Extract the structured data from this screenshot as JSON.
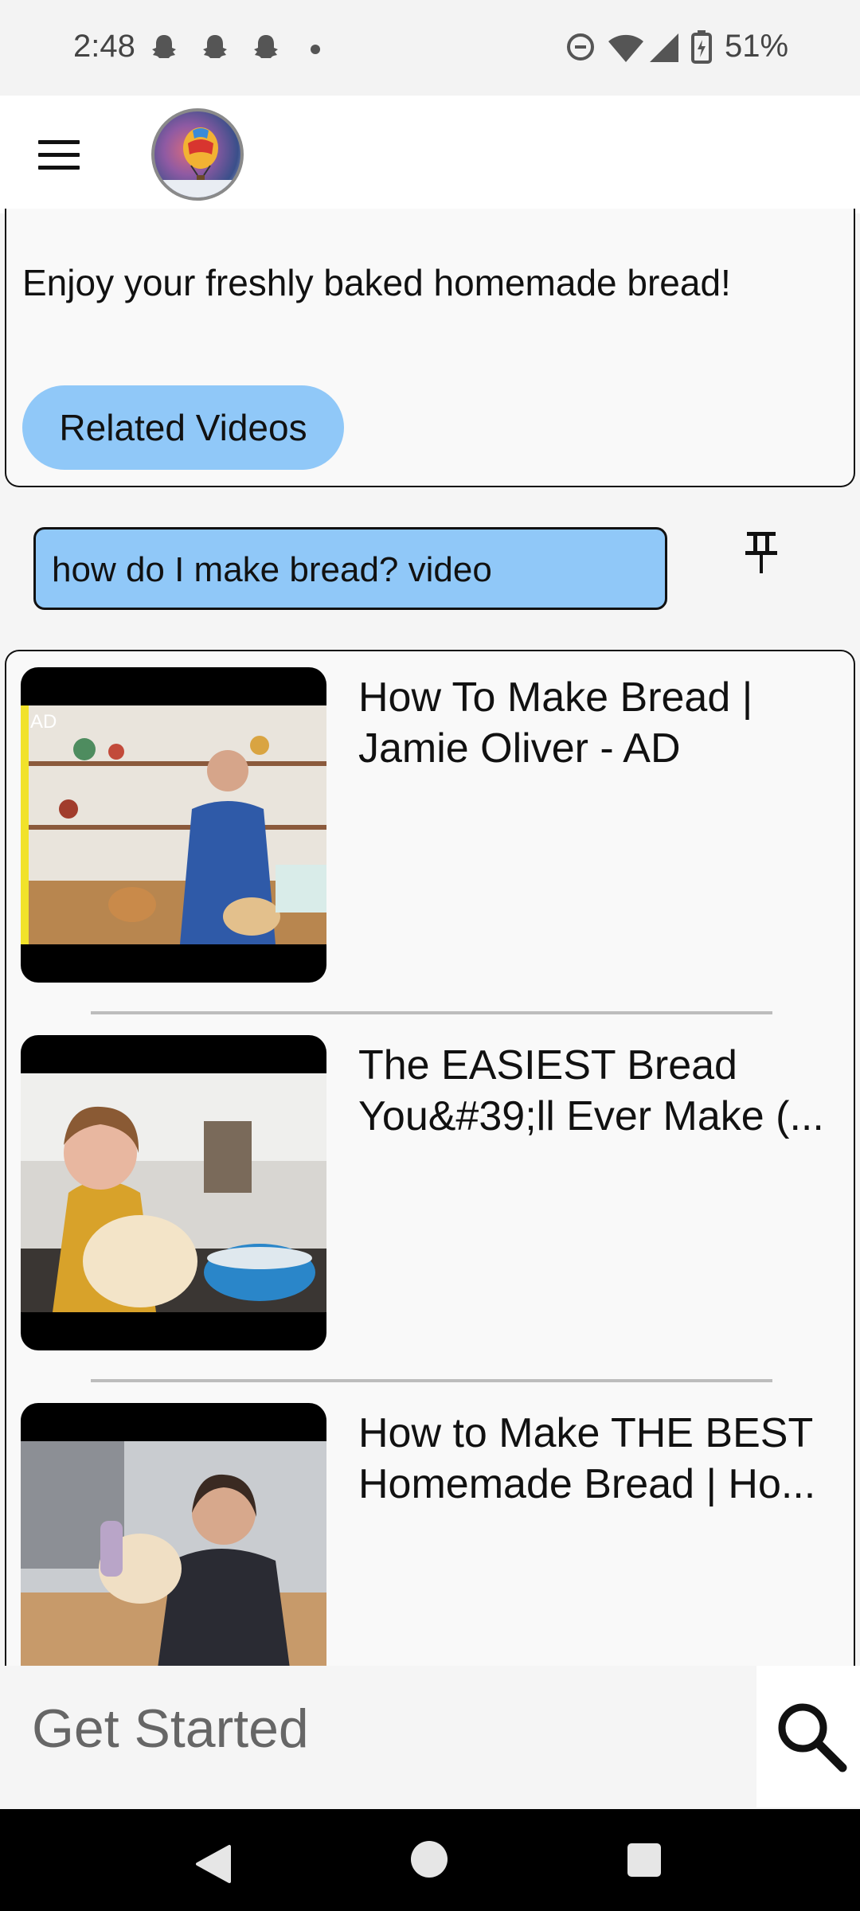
{
  "status_bar": {
    "time": "2:48",
    "battery": "51%",
    "icons": [
      "snapchat-ghost-icon",
      "snapchat-ghost-icon",
      "snapchat-ghost-icon",
      "dot-icon",
      "do-not-disturb-icon",
      "wifi-icon",
      "signal-icon",
      "battery-charging-icon"
    ]
  },
  "app_bar": {
    "menu_icon": "hamburger-menu-icon",
    "logo": "hot-air-balloon-logo"
  },
  "answer": {
    "text": "Enjoy your freshly baked homemade bread!",
    "related_button": "Related Videos"
  },
  "query": {
    "text": "how do I make bread? video",
    "pin_icon": "pin-icon"
  },
  "videos": [
    {
      "title": "How To Make Bread | Jamie Oliver - AD",
      "thumb_badge": "AD"
    },
    {
      "title": "The EASIEST Bread You&#39;ll Ever Make (...",
      "thumb_badge": ""
    },
    {
      "title": "How to Make THE BEST Homemade Bread | Ho...",
      "thumb_badge": ""
    }
  ],
  "search": {
    "placeholder": "Get Started",
    "icon": "search-icon"
  },
  "nav": {
    "back": "back-icon",
    "home": "home-icon",
    "recents": "recents-icon"
  },
  "colors": {
    "chip": "#90c8f8",
    "surface": "#f9f9f9",
    "navbar": "#000000"
  }
}
